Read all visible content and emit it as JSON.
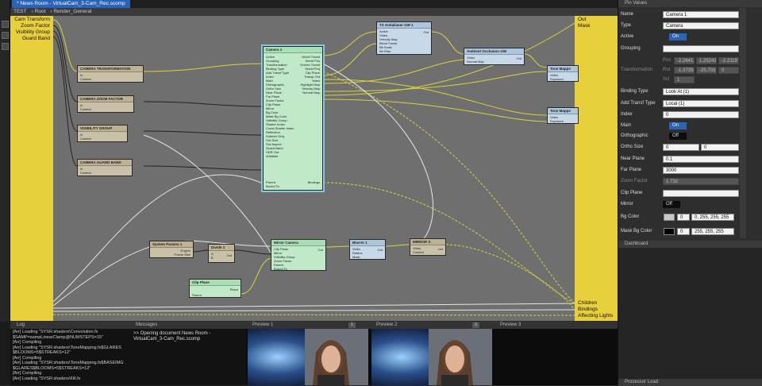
{
  "document_tab": "* News Room - VirtualCam_3-Cam_Rec.scomp",
  "breadcrumb": [
    "TEST",
    "Root",
    "Render_General"
  ],
  "input_ports": [
    "Cam Transform",
    "Zoom Factor",
    "Visibility Group",
    "Guard Band"
  ],
  "output_ports_top": [
    "Out",
    "Mask"
  ],
  "output_ports_bottom": [
    "Children",
    "Bindings",
    "Affecting Lights"
  ],
  "nodes": {
    "cam_transformation": {
      "title": "CAMERA TRANSFORMATION",
      "in": "In",
      "out": "Out",
      "extra": "Context"
    },
    "cam_zoom": {
      "title": "CAMERA ZOOM FACTOR",
      "in": "In",
      "out": "Out",
      "extra": "Context"
    },
    "visibility": {
      "title": "VISIBILITY GROUP",
      "in": "In",
      "out": "Out",
      "extra": "Context"
    },
    "guard_band": {
      "title": "CAMERA GUARD BAND",
      "in": "In",
      "out": "Out",
      "extra": "Context"
    },
    "camera1": {
      "title": "Camera 1",
      "inputs": [
        "Active",
        "Grouping",
        "Transformation",
        "Binding Type",
        "Add Transf Type",
        "Index",
        "Main",
        "Orthographic",
        "Ortho Size",
        "Near Plane",
        "Far Plane",
        "Zoom Factor",
        "Clip Plane",
        "Mirror",
        "Bg Color",
        "Mask Bg Color",
        "Visibility Group",
        "Shader Index",
        "Const Shader Index",
        "Reflection",
        "Subtree Only",
        "Out Size",
        "Out Aspect",
        "Guard Band",
        "HDR Out",
        "Antialias"
      ],
      "outputs": [
        "World Transf",
        "World Pos",
        "Screen Transf",
        "World Proj",
        "Clip Plane",
        "Transp Out",
        "Mask",
        "Highlight Map",
        "Velocity Map",
        "Normal Map"
      ],
      "footer": [
        "Parent",
        "Bound To"
      ],
      "bindings": "Bindings"
    },
    "tx_antialiaser": {
      "title": "TX Antialiaser GW 1",
      "inputs": [
        "Active",
        "Video",
        "Velocity Map",
        "Blend Factor",
        "Blt Scale",
        "Blt Filter"
      ],
      "out": "Out"
    },
    "ambient_occlusion": {
      "title": "Ambient Occlusion GW",
      "inputs": [
        "Video",
        "Normal Map"
      ],
      "out": "Out"
    },
    "tone_mapper_1": {
      "title": "Tone Mappe",
      "inputs": [
        "Video",
        "Exposure"
      ]
    },
    "tone_mapper_2": {
      "title": "Tone Mappe",
      "inputs": [
        "Video",
        "Exposure"
      ]
    },
    "system_params": {
      "title": "System Params 1",
      "outputs": [
        "Engine",
        "Frame Size"
      ]
    },
    "divide": {
      "title": "Divide 1",
      "inputs": [
        "A",
        "B"
      ],
      "out": "Out"
    },
    "mirror_camera": {
      "title": "Mirror Camera",
      "inputs": [
        "Clip Plane",
        "Mirror",
        "Visibility Group",
        "Zoom Factor"
      ],
      "out": "Out",
      "footer": [
        "Parent",
        "Bound To"
      ]
    },
    "blurrer": {
      "title": "Blurrer 1",
      "inputs": [
        "Video",
        "Radius",
        "Mask"
      ],
      "out": "Out"
    },
    "mirror_s": {
      "title": "MIRROR S",
      "inputs": [
        "Video",
        "Context"
      ],
      "out": "Out"
    },
    "clip_plane": {
      "title": "Clip Plane",
      "out": "Plane",
      "extra": "Parent"
    }
  },
  "log": {
    "title": "Log",
    "lines": [
      "[Arr] Loading \"SYSR:shaders\\Convolution.fx",
      "$SAMP=sampLinearClamp@NUMSTEPS=15\"",
      "[Arr]      Compiling",
      "[Arr] Loading \"SYSR:shaders\\ToneMapping.fx$GLARES",
      "$BLOOMS=5$STREAKS=12\"",
      "[Arr]      Compiling",
      "[Arr] Loading \"SYSR:shaders\\ToneMapping.fx$BASEIMG",
      "$GLARES$BLOOMS=5$STREAKS=12\"",
      "[Arr]      Compiling",
      "[Arr] Loading \"SYSR:shaders\\Fill.fx"
    ]
  },
  "messages": {
    "title": "Messages",
    "text": ">> Opening document News Room - VirtualCam_3-Cam_Rec.scomp"
  },
  "previews": [
    {
      "title": "Preview 1",
      "number": "1"
    },
    {
      "title": "Preview 2",
      "number": "2"
    },
    {
      "title": "Preview 3",
      "number": ""
    }
  ],
  "pin_values": {
    "title": "Pin Values",
    "name_label": "Name",
    "name_value": "Camera 1",
    "type_label": "Type",
    "type_value": "Camera",
    "active_label": "Active",
    "active_value": "On",
    "grouping_label": "Grouping",
    "transformation_label": "Transformation",
    "pos_label": "Pos",
    "pos_values": [
      "-2.26412",
      "1.25243",
      "-2.21197"
    ],
    "rot_label": "Rot",
    "rot_values": [
      "-1.37358",
      "-25.703",
      "0"
    ],
    "scl_label": "Scl",
    "scl_values": [
      "1"
    ],
    "binding_type_label": "Binding Type",
    "binding_type_value": "Look At (1)",
    "add_transf_label": "Add Transf Type",
    "add_transf_value": "Local (1)",
    "index_label": "Index",
    "index_value": "0",
    "main_label": "Main",
    "main_value": "On",
    "ortho_label": "Orthographic",
    "ortho_value": "Off",
    "ortho_size_label": "Ortho Size",
    "ortho_size_values": [
      "0",
      "0"
    ],
    "near_label": "Near Plane",
    "near_value": "0.1",
    "far_label": "Far Plane",
    "far_value": "3000",
    "zoom_label": "Zoom Factor",
    "zoom_value": "1.732",
    "clip_label": "Clip Plane",
    "mirror_label": "Mirror",
    "mirror_value": "Off",
    "bg_label": "Bg Color",
    "bg_alpha": "0",
    "bg_value": "0, 255, 255, 255",
    "bg_swatch": "#c8c8c8",
    "maskbg_label": "Mask Bg Color",
    "maskbg_alpha": "0",
    "maskbg_value": "255, 255, 255",
    "maskbg_swatch": "#000000"
  },
  "dashboard": {
    "title": "Dashboard"
  },
  "processor_load": {
    "title": "Processor Load"
  },
  "colors": {
    "accent": "#2b63b8",
    "port_bar": "#e8cf3c",
    "node_green": "#bfe9c9",
    "node_tan": "#c9c1a7",
    "node_blue": "#c7d8e8"
  }
}
